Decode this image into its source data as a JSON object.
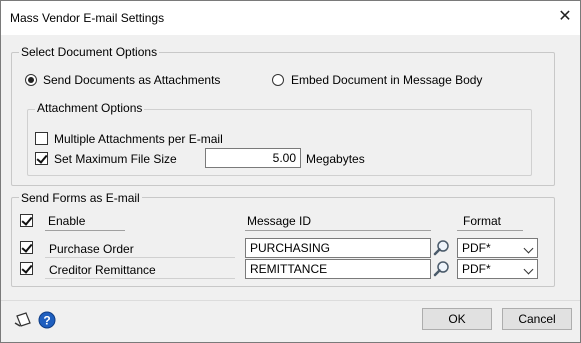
{
  "window": {
    "title": "Mass Vendor E-mail Settings"
  },
  "select_document_options": {
    "legend": "Select Document Options",
    "radio_attachments": "Send Documents as Attachments",
    "radio_embed": "Embed Document in Message Body",
    "selected": "attachments"
  },
  "attachment_options": {
    "legend": "Attachment Options",
    "multiple_label": "Multiple Attachments per E-mail",
    "multiple_checked": false,
    "maxsize_label": "Set Maximum File Size",
    "maxsize_checked": true,
    "maxsize_value": "5.00",
    "maxsize_unit": "Megabytes"
  },
  "send_forms": {
    "legend": "Send Forms as E-mail",
    "headers": {
      "enable": "Enable",
      "message_id": "Message ID",
      "format": "Format"
    },
    "rows": [
      {
        "label": "Purchase Order",
        "enabled": true,
        "message_id": "PURCHASING",
        "format": "PDF*"
      },
      {
        "label": "Creditor Remittance",
        "enabled": true,
        "message_id": "REMITTANCE",
        "format": "PDF*"
      }
    ]
  },
  "buttons": {
    "ok": "OK",
    "cancel": "Cancel"
  },
  "icons": {
    "note": "note-icon",
    "help": "help-icon",
    "lookup": "magnifier-icon",
    "close": "close-icon"
  },
  "colors": {
    "help_blue": "#1f5fbf"
  }
}
